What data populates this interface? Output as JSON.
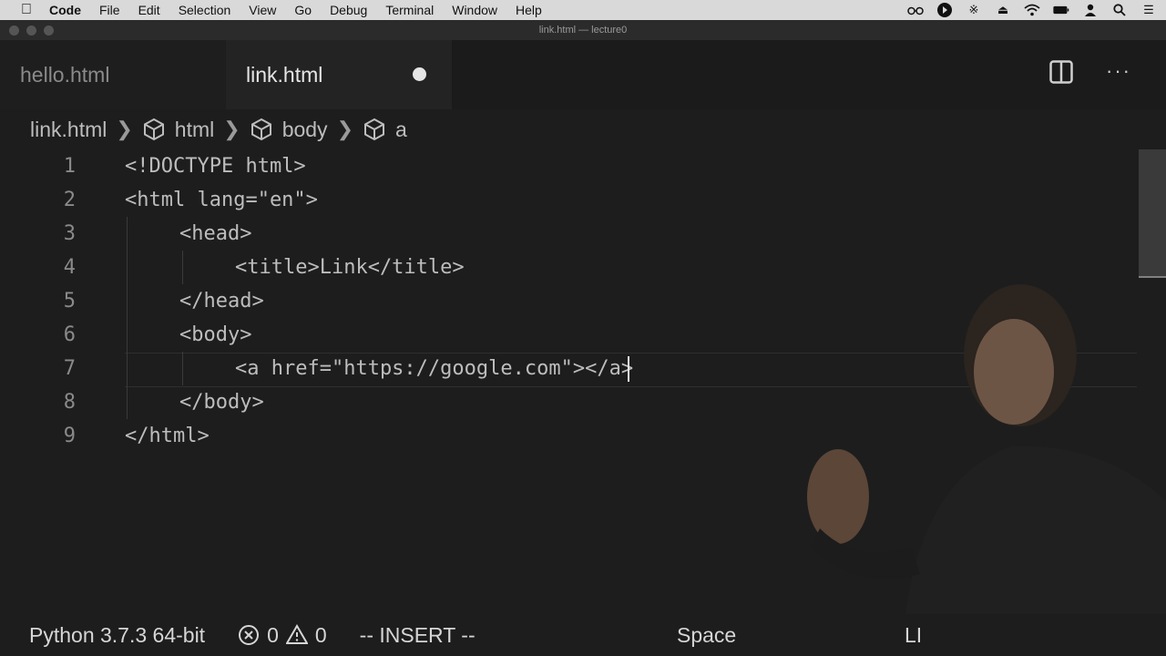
{
  "menubar": {
    "app": "Code",
    "items": [
      "File",
      "Edit",
      "Selection",
      "View",
      "Go",
      "Debug",
      "Terminal",
      "Window",
      "Help"
    ]
  },
  "window": {
    "title": "link.html — lecture0"
  },
  "tabs": [
    {
      "label": "hello.html",
      "active": false
    },
    {
      "label": "link.html",
      "active": true,
      "unsaved": true
    }
  ],
  "breadcrumb": [
    "link.html",
    "html",
    "body",
    "a"
  ],
  "editor": {
    "line_numbers": [
      "1",
      "2",
      "3",
      "4",
      "5",
      "6",
      "7",
      "8",
      "9"
    ],
    "lines": [
      "<!DOCTYPE html>",
      "<html lang=\"en\">",
      "<head>",
      "<title>Link</title>",
      "</head>",
      "<body>",
      "<a href=\"https://google.com\"></a>",
      "</body>",
      "</html>"
    ],
    "cursor_line": "7"
  },
  "statusbar": {
    "interpreter": "Python 3.7.3 64-bit",
    "errors": "0",
    "warnings": "0",
    "mode": "-- INSERT --",
    "spaces": "Space",
    "eol": "LI"
  },
  "colors": {
    "background": "#1d1d1d",
    "menubar": "#d9d9d9",
    "text": "#cfcfcf"
  },
  "icons": [
    "apple-icon",
    "glasses-icon",
    "play-icon",
    "bluetooth-icon",
    "eject-icon",
    "wifi-icon",
    "battery-icon",
    "user-icon",
    "search-icon",
    "list-icon",
    "split-editor-icon",
    "more-icon",
    "symbol-cube-icon",
    "error-icon",
    "warning-icon"
  ]
}
